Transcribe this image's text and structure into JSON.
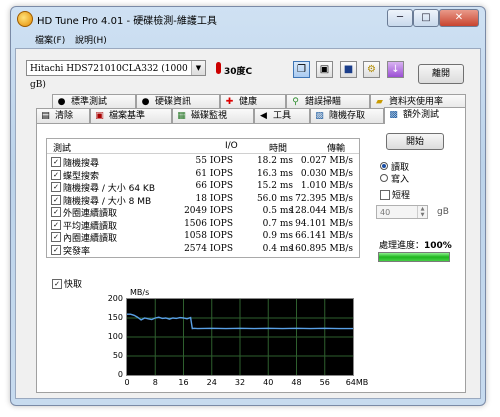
{
  "window": {
    "title": "HD Tune Pro 4.01 - 硬碟檢測-維護工具",
    "buttons": {
      "minimize": "─",
      "maximize": "□",
      "close": "✕"
    }
  },
  "menu": {
    "file": "檔案(F)",
    "help": "說明(H)"
  },
  "toolbar": {
    "drive": "Hitachi HDS721010CLA332 (1000 gB)",
    "temperature": "30度C",
    "exit_label": "離開",
    "icons": [
      "copy-text-icon",
      "copy-screen-icon",
      "save-icon",
      "options-icon",
      "download-icon"
    ]
  },
  "tabs_row1": [
    "標準測試",
    "硬碟資訊",
    "健康",
    "錯誤掃瞄",
    "資料夾使用率"
  ],
  "tabs_row2": [
    "清除",
    "檔案基準",
    "磁碟監視",
    "工具",
    "隨機存取",
    "額外測試"
  ],
  "active_tab": "額外測試",
  "grid": {
    "headers": {
      "test": "測試",
      "io": "I/O",
      "time": "時間",
      "rate": "傳輸"
    },
    "rows": [
      {
        "check": "✓",
        "name": "隨機搜尋",
        "io": "55 IOPS",
        "time": "18.2 ms",
        "rate": "0.027 MB/s"
      },
      {
        "check": "✓",
        "name": "蝶型搜索",
        "io": "61 IOPS",
        "time": "16.3 ms",
        "rate": "0.030 MB/s"
      },
      {
        "check": "✓",
        "name": "隨機搜尋 / 大小 64 KB",
        "io": "66 IOPS",
        "time": "15.2 ms",
        "rate": "1.010 MB/s"
      },
      {
        "check": "✓",
        "name": "隨機搜尋 / 大小 8 MB",
        "io": "18 IOPS",
        "time": "56.0 ms",
        "rate": "72.395 MB/s"
      },
      {
        "check": "✓",
        "name": "外圈連續讀取",
        "io": "2049 IOPS",
        "time": "0.5 ms",
        "rate": "128.044 MB/s"
      },
      {
        "check": "✓",
        "name": "平均連續讀取",
        "io": "1506 IOPS",
        "time": "0.7 ms",
        "rate": "94.101 MB/s"
      },
      {
        "check": "✓",
        "name": "內圈連續讀取",
        "io": "1058 IOPS",
        "time": "0.9 ms",
        "rate": "66.141 MB/s"
      },
      {
        "check": "✓",
        "name": "突發率",
        "io": "2574 IOPS",
        "time": "0.4 ms",
        "rate": "160.895 MB/s"
      }
    ]
  },
  "side": {
    "start": "開始",
    "read": "讀取",
    "write": "寫入",
    "short_stroke": "短程",
    "stroke_value": "40",
    "stroke_unit": "gB",
    "progress_label": "處理進度：",
    "progress_value": "100%",
    "progress_fraction": 1.0
  },
  "cache_label": "快取",
  "cache_check": "✓",
  "chart_data": {
    "type": "line",
    "ylabel": "MB/s",
    "xlabel": "",
    "ylim": [
      0,
      200
    ],
    "xlim": [
      0,
      64
    ],
    "yticks": [
      "200",
      "150",
      "100",
      "50",
      "0"
    ],
    "xticks": [
      "0",
      "8",
      "16",
      "24",
      "32",
      "40",
      "48",
      "56",
      "64MB"
    ],
    "x_unit": "MB",
    "colors": {
      "line": "#5aa0e6",
      "grid": "#2e5f2e",
      "bg": "#000000"
    },
    "series": [
      {
        "x": [
          0,
          1,
          2,
          3,
          4,
          5,
          6,
          7,
          8,
          9,
          10,
          11,
          12,
          13,
          14,
          15,
          16,
          17,
          18,
          18.5,
          19,
          20,
          24,
          28,
          32,
          36,
          40,
          44,
          48,
          52,
          56,
          60,
          64
        ],
        "values": [
          160,
          160,
          157,
          152,
          145,
          150,
          148,
          146,
          150,
          152,
          149,
          150,
          147,
          150,
          149,
          151,
          150,
          148,
          151,
          122,
          123,
          122,
          123,
          122,
          123,
          122,
          123,
          122,
          123,
          122,
          123,
          122,
          122
        ]
      }
    ]
  }
}
